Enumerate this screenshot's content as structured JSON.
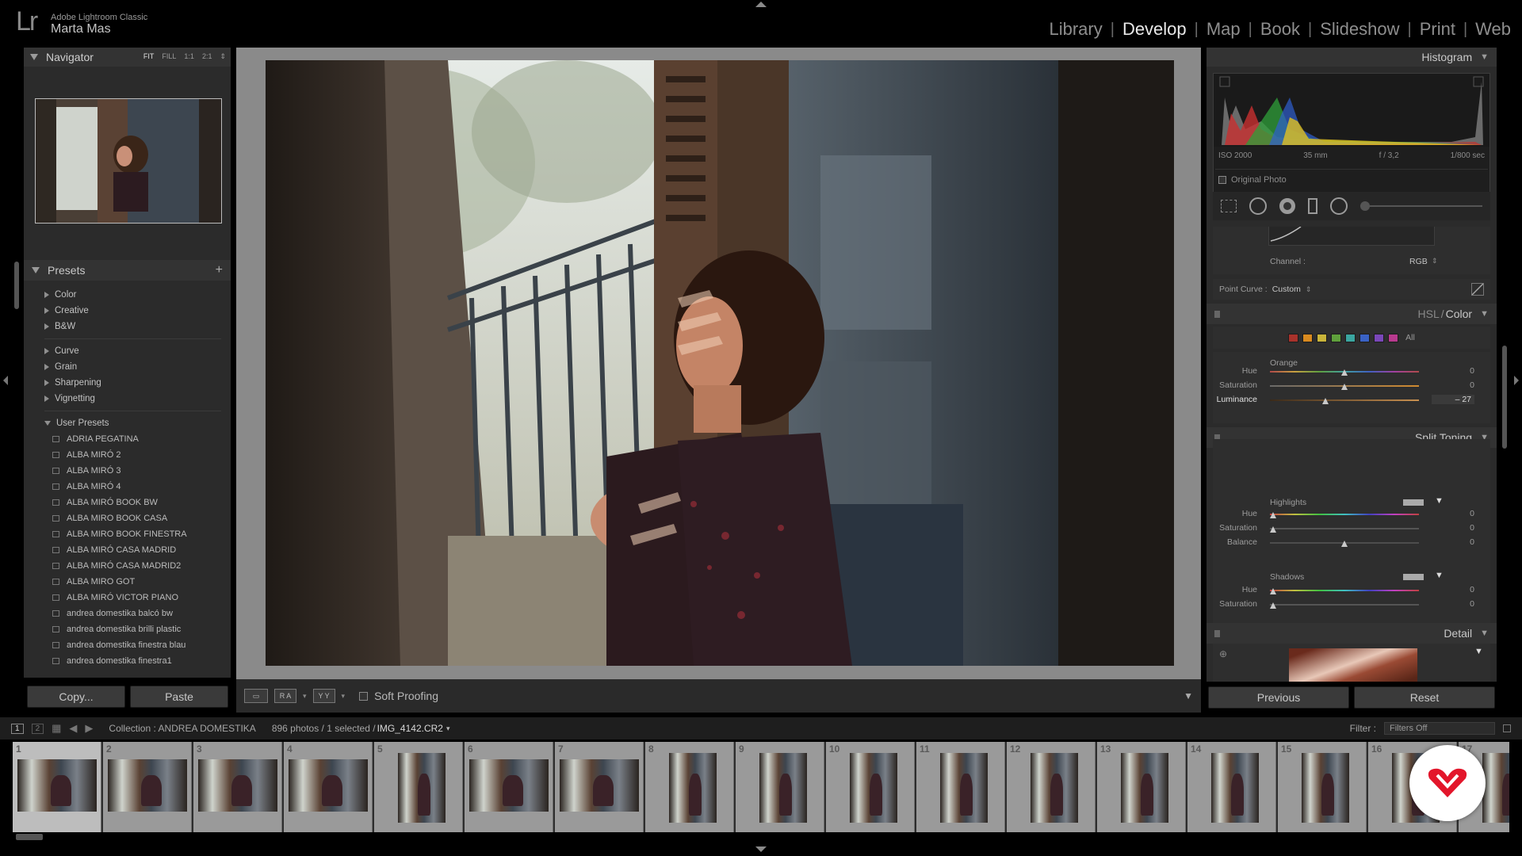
{
  "app": {
    "product": "Adobe Lightroom Classic",
    "user": "Marta Mas",
    "logo": "Lr"
  },
  "modules": [
    {
      "label": "Library",
      "active": false
    },
    {
      "label": "Develop",
      "active": true
    },
    {
      "label": "Map",
      "active": false
    },
    {
      "label": "Book",
      "active": false
    },
    {
      "label": "Slideshow",
      "active": false
    },
    {
      "label": "Print",
      "active": false
    },
    {
      "label": "Web",
      "active": false
    }
  ],
  "navigator": {
    "title": "Navigator",
    "zoom": [
      "FIT",
      "FILL",
      "1:1",
      "2:1"
    ]
  },
  "presets": {
    "title": "Presets",
    "groups": [
      [
        "Color",
        "Creative",
        "B&W"
      ],
      [
        "Curve",
        "Grain",
        "Sharpening",
        "Vignetting"
      ]
    ],
    "user_title": "User Presets",
    "user_items": [
      "ADRIA PEGATINA",
      "ALBA MIRÓ 2",
      "ALBA MIRÓ 3",
      "ALBA MIRÓ 4",
      "ALBA MIRÓ BOOK BW",
      "ALBA MIRO BOOK CASA",
      "ALBA MIRO BOOK FINESTRA",
      "ALBA MIRÓ CASA MADRID",
      "ALBA MIRÓ CASA MADRID2",
      "ALBA MIRO GOT",
      "ALBA MIRÓ VICTOR PIANO",
      "andrea domestika balcó bw",
      "andrea domestika brilli plastic",
      "andrea domestika finestra blau",
      "andrea domestika finestra1"
    ]
  },
  "left_buttons": {
    "copy": "Copy...",
    "paste": "Paste"
  },
  "toolbar": {
    "soft_proofing": "Soft Proofing",
    "ra": "R A",
    "yy": "Y Y"
  },
  "histogram": {
    "title": "Histogram",
    "iso": "ISO 2000",
    "focal": "35 mm",
    "aperture": "f / 3,2",
    "shutter": "1/800 sec",
    "original_photo": "Original Photo"
  },
  "tone_curve": {
    "channel_label": "Channel :",
    "channel_value": "RGB",
    "point_curve_label": "Point Curve :",
    "point_curve_value": "Custom"
  },
  "hsl": {
    "title_hsl": "HSL",
    "title_sep": "/",
    "title_color": "Color",
    "all_label": "All",
    "swatches": [
      "#a8322b",
      "#d98a1f",
      "#c9b43a",
      "#5fa03c",
      "#3ba6a0",
      "#3a62c4",
      "#7a47b8",
      "#b83a8e"
    ],
    "color_name": "Orange",
    "rows": [
      {
        "label": "Hue",
        "value": "0",
        "pos": 0.5
      },
      {
        "label": "Saturation",
        "value": "0",
        "pos": 0.5
      },
      {
        "label": "Luminance",
        "value": "– 27",
        "pos": 0.37
      }
    ]
  },
  "split_toning": {
    "title": "Split Toning",
    "highlights": "Highlights",
    "shadows": "Shadows",
    "balance_label": "Balance",
    "balance_value": "0",
    "h_rows": [
      {
        "label": "Hue",
        "value": "0"
      },
      {
        "label": "Saturation",
        "value": "0"
      }
    ],
    "s_rows": [
      {
        "label": "Hue",
        "value": "0"
      },
      {
        "label": "Saturation",
        "value": "0"
      }
    ]
  },
  "detail": {
    "title": "Detail"
  },
  "right_buttons": {
    "previous": "Previous",
    "reset": "Reset"
  },
  "filmstrip_bar": {
    "page1": "1",
    "page2": "2",
    "collection": "Collection : ANDREA DOMESTIKA",
    "count": "896 photos / 1 selected /",
    "filename": "IMG_4142.CR2",
    "filter_label": "Filter :",
    "filter_value": "Filters Off"
  },
  "filmstrip": {
    "cells": [
      {
        "n": "1",
        "orient": "land",
        "sel": true
      },
      {
        "n": "2",
        "orient": "land"
      },
      {
        "n": "3",
        "orient": "land"
      },
      {
        "n": "4",
        "orient": "land"
      },
      {
        "n": "5",
        "orient": "port"
      },
      {
        "n": "6",
        "orient": "land"
      },
      {
        "n": "7",
        "orient": "land"
      },
      {
        "n": "8",
        "orient": "port"
      },
      {
        "n": "9",
        "orient": "port"
      },
      {
        "n": "10",
        "orient": "port"
      },
      {
        "n": "11",
        "orient": "port"
      },
      {
        "n": "12",
        "orient": "port"
      },
      {
        "n": "13",
        "orient": "port"
      },
      {
        "n": "14",
        "orient": "port"
      },
      {
        "n": "15",
        "orient": "port"
      },
      {
        "n": "16",
        "orient": "port"
      },
      {
        "n": "17",
        "orient": "port"
      }
    ]
  }
}
